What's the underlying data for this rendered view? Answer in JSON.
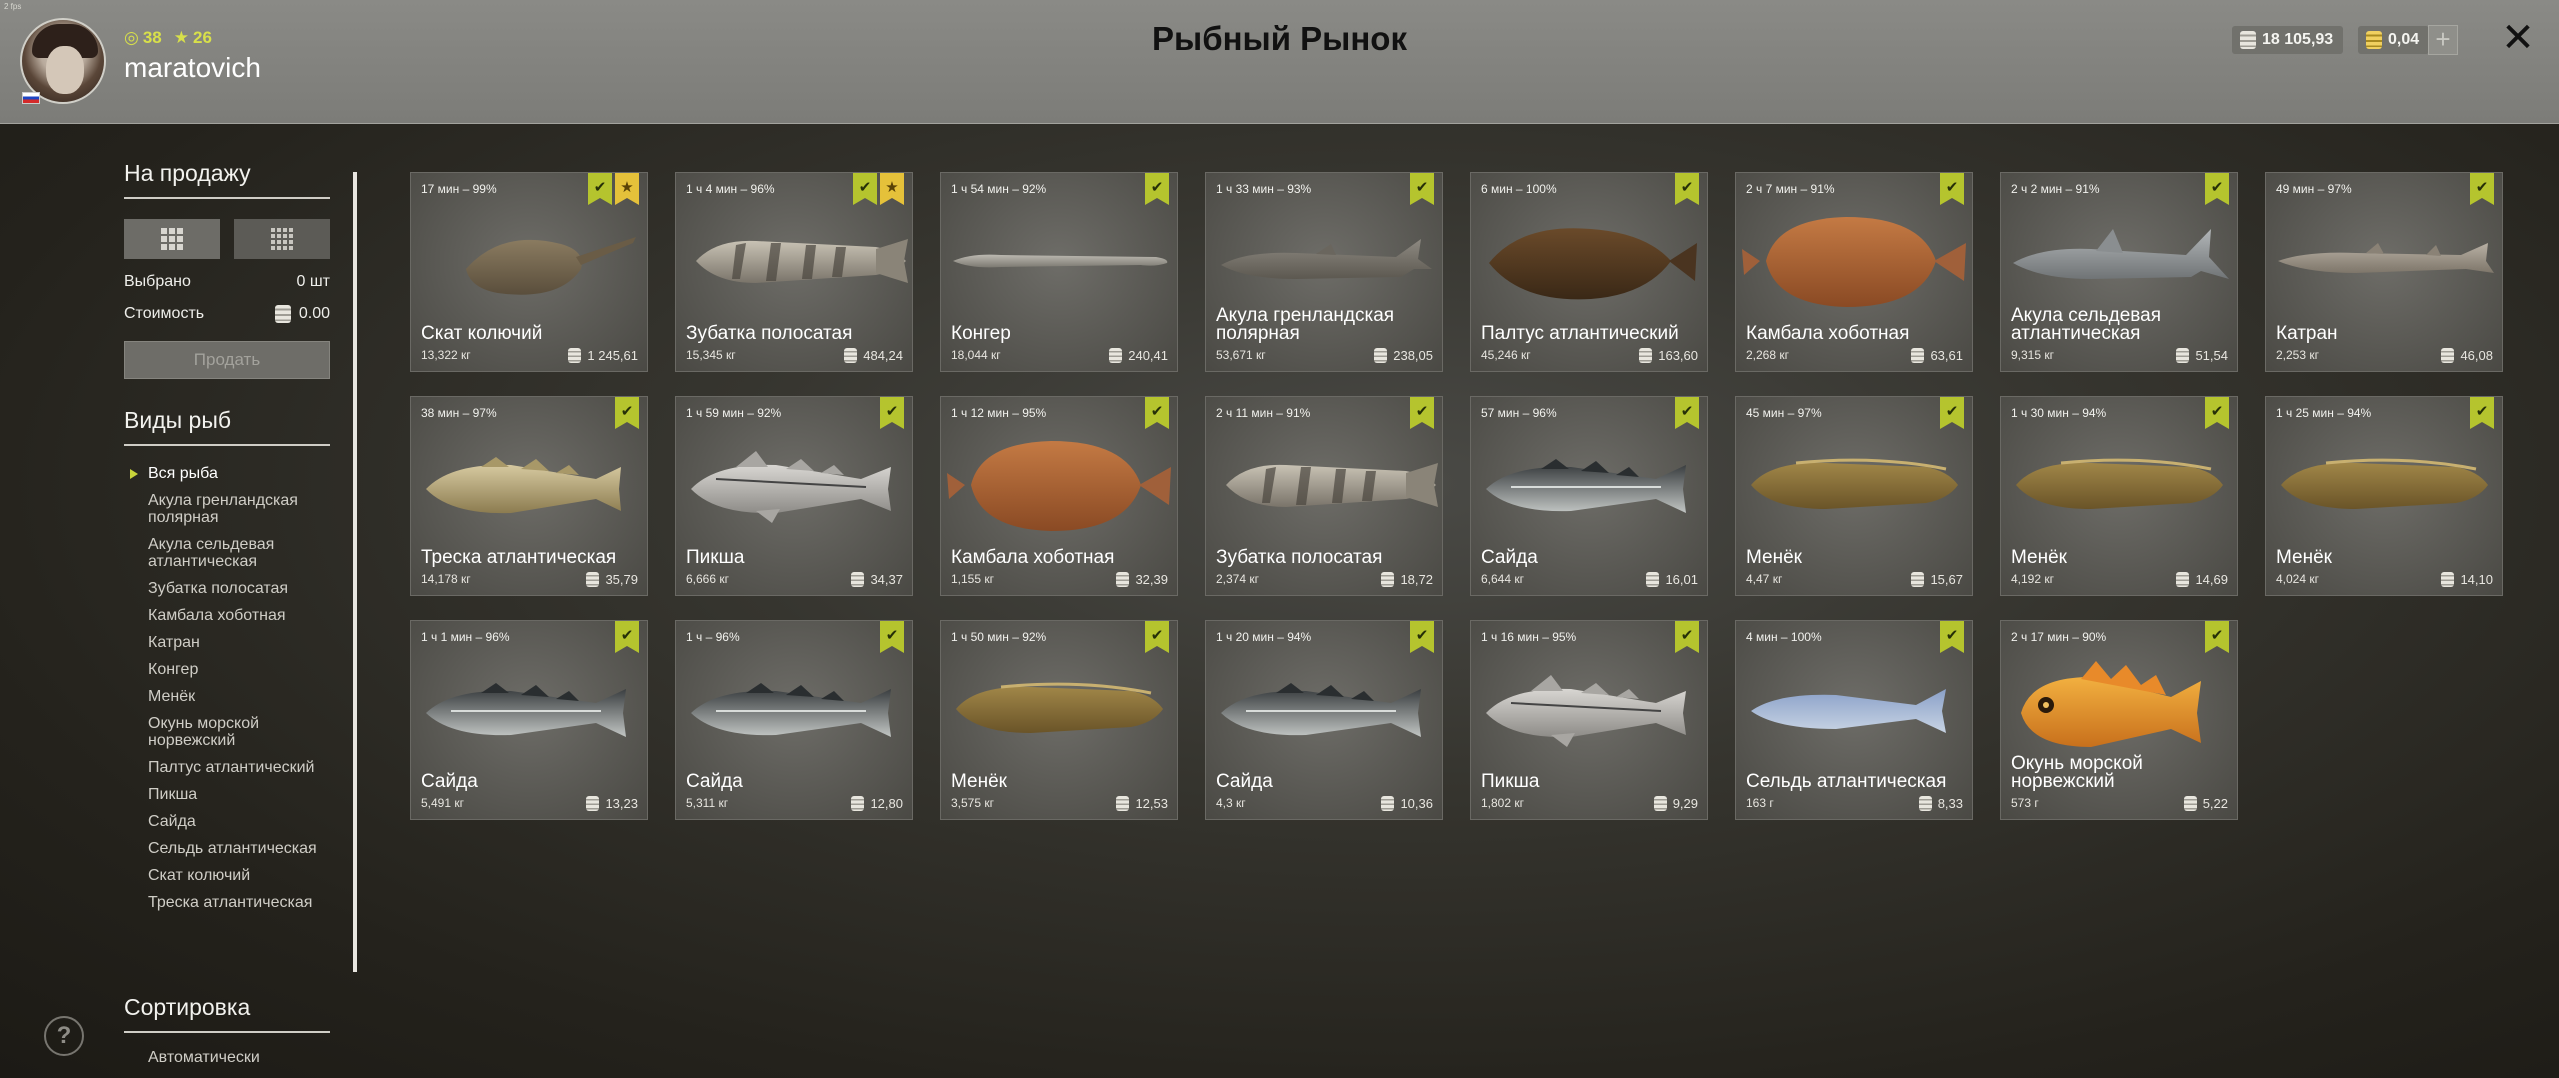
{
  "fps": "2 fps",
  "player": {
    "level": "38",
    "rank": "26",
    "username": "maratovich"
  },
  "title": "Рыбный Рынок",
  "wallet": {
    "silver": "18 105,93",
    "gold": "0,04"
  },
  "sidebar": {
    "for_sale": "На продажу",
    "selected_label": "Выбрано",
    "selected_value": "0 шт",
    "cost_label": "Стоимость",
    "cost_value": "0.00",
    "sell_button": "Продать",
    "species_title": "Виды рыб",
    "species": [
      "Вся рыба",
      "Акула гренландская полярная",
      "Акула сельдевая атлантическая",
      "Зубатка полосатая",
      "Камбала хоботная",
      "Катран",
      "Конгер",
      "Менёк",
      "Окунь морской норвежский",
      "Палтус атлантический",
      "Пикша",
      "Сайда",
      "Сельдь атлантическая",
      "Скат колючий",
      "Треска атлантическая"
    ],
    "active_species_index": 0,
    "sort_title": "Сортировка",
    "sort_value": "Автоматически"
  },
  "colors": {
    "check_badge": "#b5c42e",
    "star_badge": "#e5c13a",
    "stats_yellow": "#d8e04a"
  },
  "fish": [
    {
      "time": "17 мин – 99%",
      "name": "Скат колючий",
      "weight": "13,322 кг",
      "price": "1 245,61",
      "shape": "ray",
      "star": true
    },
    {
      "time": "1 ч 4 мин – 96%",
      "name": "Зубатка полосатая",
      "weight": "15,345 кг",
      "price": "484,24",
      "shape": "wolffish",
      "star": true
    },
    {
      "time": "1 ч 54 мин – 92%",
      "name": "Конгер",
      "weight": "18,044 кг",
      "price": "240,41",
      "shape": "eel",
      "star": false
    },
    {
      "time": "1 ч 33 мин – 93%",
      "name": "Акула гренландская полярная",
      "weight": "53,671 кг",
      "price": "238,05",
      "shape": "shark-gray",
      "star": false
    },
    {
      "time": "6 мин – 100%",
      "name": "Палтус атлантический",
      "weight": "45,246 кг",
      "price": "163,60",
      "shape": "halibut",
      "star": false
    },
    {
      "time": "2 ч 7 мин – 91%",
      "name": "Камбала хоботная",
      "weight": "2,268 кг",
      "price": "63,61",
      "shape": "flounder",
      "star": false
    },
    {
      "time": "2 ч 2 мин – 91%",
      "name": "Акула сельдевая атлантическая",
      "weight": "9,315 кг",
      "price": "51,54",
      "shape": "shark",
      "star": false
    },
    {
      "time": "49 мин – 97%",
      "name": "Катран",
      "weight": "2,253 кг",
      "price": "46,08",
      "shape": "dogfish",
      "star": false
    },
    {
      "time": "38 мин – 97%",
      "name": "Треска атлантическая",
      "weight": "14,178 кг",
      "price": "35,79",
      "shape": "cod",
      "star": false
    },
    {
      "time": "1 ч 59 мин – 92%",
      "name": "Пикша",
      "weight": "6,666 кг",
      "price": "34,37",
      "shape": "haddock",
      "star": false
    },
    {
      "time": "1 ч 12 мин – 95%",
      "name": "Камбала хоботная",
      "weight": "1,155 кг",
      "price": "32,39",
      "shape": "flounder",
      "star": false
    },
    {
      "time": "2 ч 11 мин – 91%",
      "name": "Зубатка полосатая",
      "weight": "2,374 кг",
      "price": "18,72",
      "shape": "wolffish",
      "star": false
    },
    {
      "time": "57 мин – 96%",
      "name": "Сайда",
      "weight": "6,644 кг",
      "price": "16,01",
      "shape": "pollock",
      "star": false
    },
    {
      "time": "45 мин – 97%",
      "name": "Менёк",
      "weight": "4,47 кг",
      "price": "15,67",
      "shape": "cusk",
      "star": false
    },
    {
      "time": "1 ч 30 мин – 94%",
      "name": "Менёк",
      "weight": "4,192 кг",
      "price": "14,69",
      "shape": "cusk",
      "star": false
    },
    {
      "time": "1 ч 25 мин – 94%",
      "name": "Менёк",
      "weight": "4,024 кг",
      "price": "14,10",
      "shape": "cusk",
      "star": false
    },
    {
      "time": "1 ч 1 мин – 96%",
      "name": "Сайда",
      "weight": "5,491 кг",
      "price": "13,23",
      "shape": "pollock",
      "star": false
    },
    {
      "time": "1 ч – 96%",
      "name": "Сайда",
      "weight": "5,311 кг",
      "price": "12,80",
      "shape": "pollock",
      "star": false
    },
    {
      "time": "1 ч 50 мин – 92%",
      "name": "Менёк",
      "weight": "3,575 кг",
      "price": "12,53",
      "shape": "cusk",
      "star": false
    },
    {
      "time": "1 ч 20 мин – 94%",
      "name": "Сайда",
      "weight": "4,3 кг",
      "price": "10,36",
      "shape": "pollock",
      "star": false
    },
    {
      "time": "1 ч 16 мин – 95%",
      "name": "Пикша",
      "weight": "1,802 кг",
      "price": "9,29",
      "shape": "haddock",
      "star": false
    },
    {
      "time": "4 мин – 100%",
      "name": "Сельдь атлантическая",
      "weight": "163 г",
      "price": "8,33",
      "shape": "herring",
      "star": false
    },
    {
      "time": "2 ч 17 мин – 90%",
      "name": "Окунь морской норвежский",
      "weight": "573 г",
      "price": "5,22",
      "shape": "redfish",
      "star": false
    }
  ]
}
